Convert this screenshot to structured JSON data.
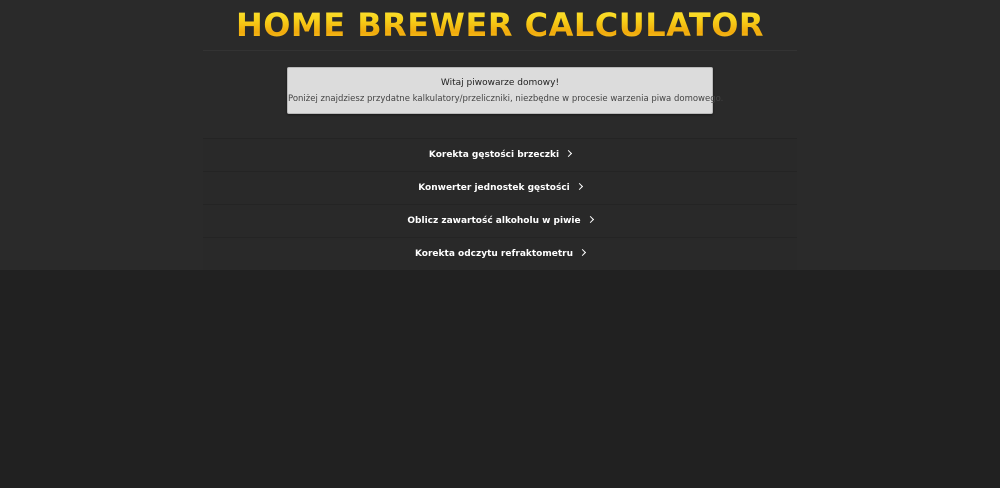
{
  "header": {
    "title": "HOME BREWER CALCULATOR"
  },
  "welcome": {
    "title": "Witaj piwowarze domowy!",
    "text": "Poniżej znajdziesz przydatne kalkulatory/przeliczniki, niezbędne w procesie warzenia piwa domowego."
  },
  "menu": {
    "items": [
      {
        "label": "Korekta gęstości brzeczki",
        "icon": "chevron-right-icon"
      },
      {
        "label": "Konwerter jednostek gęstości",
        "icon": "chevron-right-icon"
      },
      {
        "label": "Oblicz zawartość alkoholu w piwie",
        "icon": "chevron-right-icon"
      },
      {
        "label": "Korekta odczytu refraktometru",
        "icon": "chevron-right-icon"
      }
    ]
  },
  "colors": {
    "background": "#212121",
    "top_section": "#2a2a2a",
    "logo_yellow": "#f2cf0f",
    "welcome_box": "#dcdcdc",
    "menu_text": "#ffffff"
  }
}
